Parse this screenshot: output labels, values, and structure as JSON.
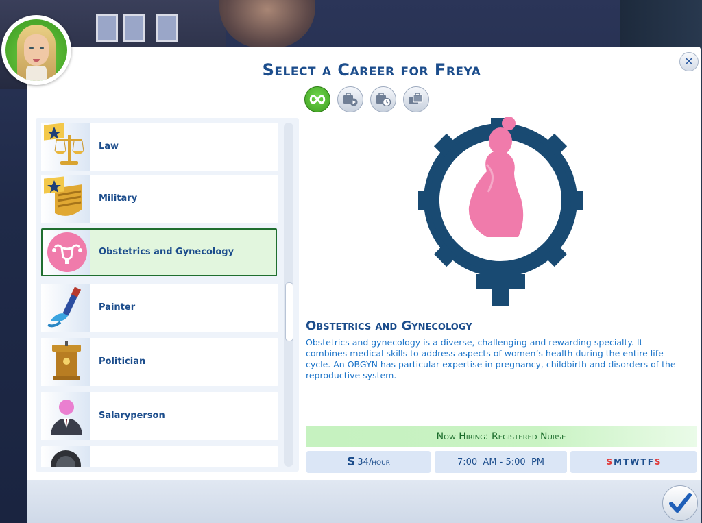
{
  "dialog": {
    "title": "Select a Career for Freya",
    "close_label": "✕",
    "confirm_icon": "checkmark-icon"
  },
  "filters": [
    {
      "icon": "infinity-icon",
      "active": true
    },
    {
      "icon": "briefcase-play-icon",
      "active": false
    },
    {
      "icon": "briefcase-clock-icon",
      "active": false
    },
    {
      "icon": "briefcase-stack-icon",
      "active": false
    }
  ],
  "careers": [
    {
      "label": "Law",
      "icon": "scales-star-icon"
    },
    {
      "label": "Military",
      "icon": "military-insignia-star-icon"
    },
    {
      "label": "Obstetrics and Gynecology",
      "icon": "uterus-icon",
      "selected": true
    },
    {
      "label": "Painter",
      "icon": "paintbrush-icon"
    },
    {
      "label": "Politician",
      "icon": "podium-icon"
    },
    {
      "label": "Salaryperson",
      "icon": "businessperson-icon"
    },
    {
      "label": "",
      "icon": "partial-career-icon"
    }
  ],
  "detail": {
    "title": "Obstetrics and Gynecology",
    "description": "Obstetrics and gynecology is a diverse, challenging and rewarding specialty. It combines medical skills to address aspects of women’s health during the entire life cycle. An OBGYN has particular expertise in pregnancy, childbirth and disorders of the reproductive system.",
    "hiring": "Now Hiring: Registered Nurse",
    "pay_symbol": "S",
    "pay": "34/hour",
    "hours": "7:00  AM - 5:00  PM",
    "days": [
      {
        "d": "S",
        "work": false
      },
      {
        "d": "M",
        "work": true
      },
      {
        "d": "T",
        "work": true
      },
      {
        "d": "W",
        "work": true
      },
      {
        "d": "T",
        "work": true
      },
      {
        "d": "F",
        "work": true
      },
      {
        "d": "S",
        "work": false
      }
    ]
  },
  "colors": {
    "accent": "#1c4d8c",
    "pink": "#f07bab",
    "navy": "#194a72",
    "green": "#1a6b2a",
    "off_day": "#e03a3a"
  }
}
